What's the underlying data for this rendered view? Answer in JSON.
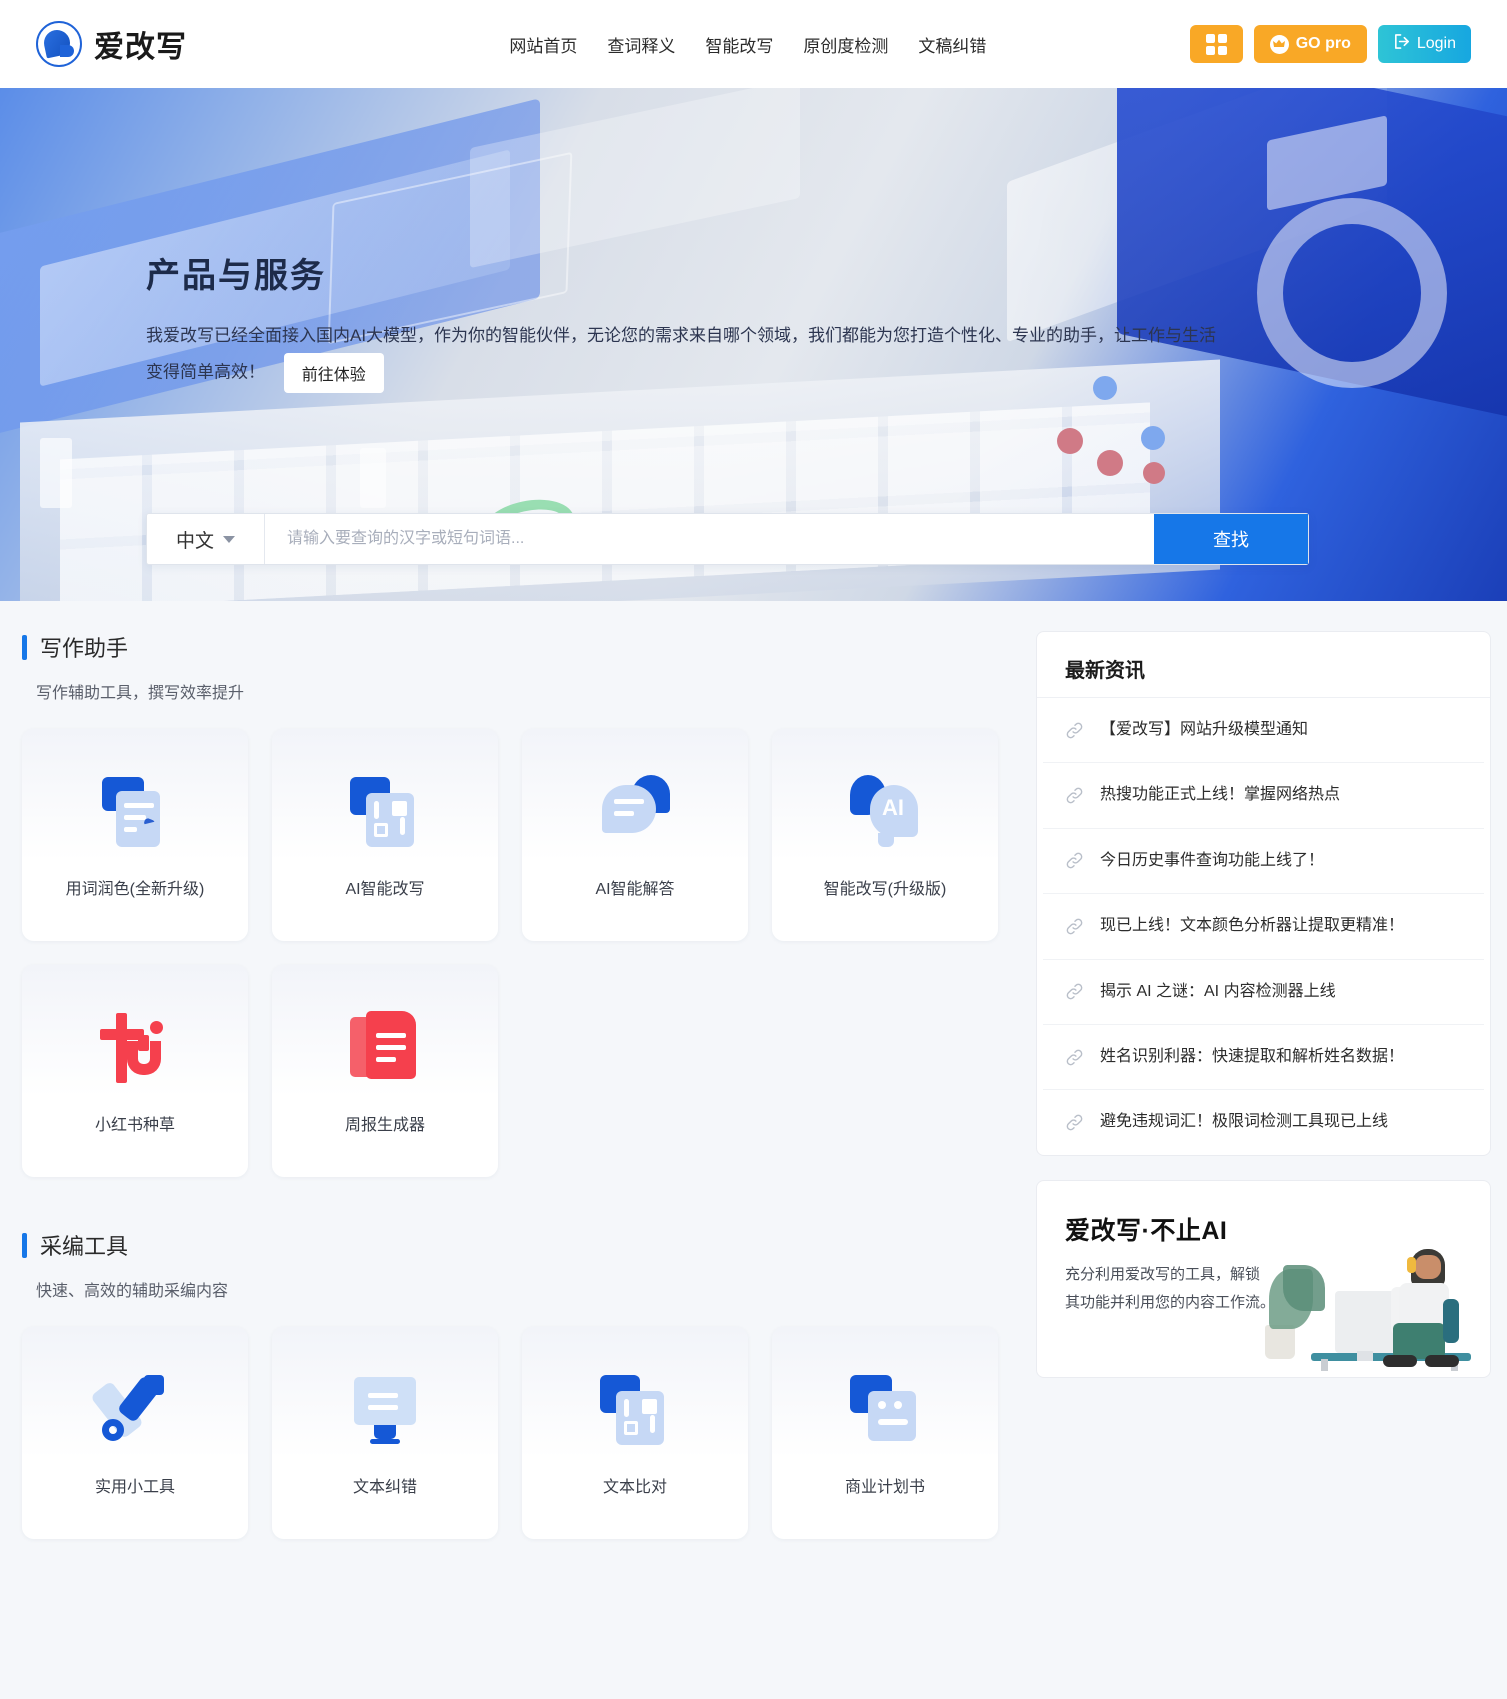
{
  "header": {
    "brand_name": "爱改写",
    "nav": [
      {
        "label": "网站首页"
      },
      {
        "label": "查词释义"
      },
      {
        "label": "智能改写"
      },
      {
        "label": "原创度检测"
      },
      {
        "label": "文稿纠错"
      }
    ],
    "pro_label": "GO pro",
    "login_label": "Login",
    "accent_orange": "#f9a826",
    "accent_login": "#1fb6d8"
  },
  "hero": {
    "title": "产品与服务",
    "description": "我爱改写已经全面接入国内AI大模型，作为你的智能伙伴，无论您的需求来自哪个领域，我们都能为您打造个性化、专业的助手，让工作与生活变得简单高效！",
    "cta_label": "前往体验"
  },
  "search": {
    "language": "中文",
    "placeholder": "请输入要查询的汉字或短句词语...",
    "button_label": "查找"
  },
  "sections": [
    {
      "title": "写作助手",
      "subtitle": "写作辅助工具，撰写效率提升",
      "cards": [
        {
          "label": "用词润色(全新升级)",
          "icon": "document-cursor-icon"
        },
        {
          "label": "AI智能改写",
          "icon": "rewrite-arrows-icon"
        },
        {
          "label": "AI智能解答",
          "icon": "chat-bubble-icon"
        },
        {
          "label": "智能改写(升级版)",
          "icon": "ai-head-icon"
        },
        {
          "label": "小红书种草",
          "icon": "xiaohongshu-book-icon"
        },
        {
          "label": "周报生成器",
          "icon": "report-doc-icon"
        }
      ]
    },
    {
      "title": "采编工具",
      "subtitle": "快速、高效的辅助采编内容",
      "cards": [
        {
          "label": "实用小工具",
          "icon": "wrench-tools-icon"
        },
        {
          "label": "文本纠错",
          "icon": "swap-screen-icon"
        },
        {
          "label": "文本比对",
          "icon": "compare-arrows-icon"
        },
        {
          "label": "商业计划书",
          "icon": "business-plan-icon"
        }
      ]
    }
  ],
  "news": {
    "title": "最新资讯",
    "items": [
      {
        "text": "【爱改写】网站升级模型通知"
      },
      {
        "text": "热搜功能正式上线！掌握网络热点"
      },
      {
        "text": "今日历史事件查询功能上线了！"
      },
      {
        "text": "现已上线！文本颜色分析器让提取更精准！"
      },
      {
        "text": "揭示 AI 之谜：AI 内容检测器上线"
      },
      {
        "text": "姓名识别利器：快速提取和解析姓名数据！"
      },
      {
        "text": "避免违规词汇！极限词检测工具现已上线"
      }
    ]
  },
  "promo": {
    "title": "爱改写·不止AI",
    "line1": "充分利用爱改写的工具，解锁",
    "line2": "其功能并利用您的内容工作流。"
  }
}
